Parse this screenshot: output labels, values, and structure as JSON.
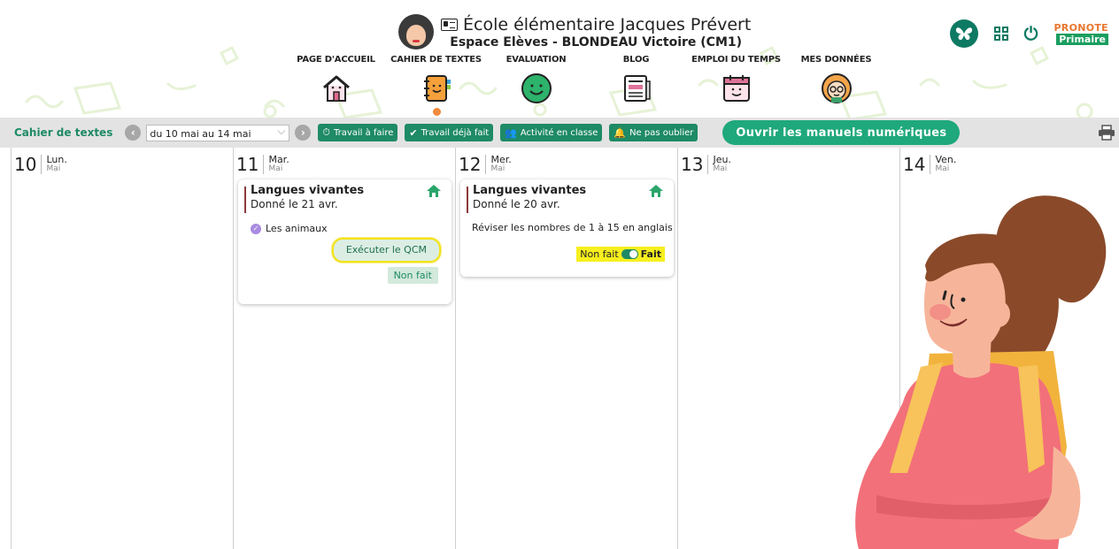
{
  "header": {
    "school_name": "École élémentaire Jacques Prévert",
    "student_line": "Espace Elèves - BLONDEAU Victoire (CM1)",
    "brand_top": "PRONOTE",
    "brand_bottom": "Primaire",
    "icons": [
      "butterfly-icon",
      "qr-code-icon",
      "power-icon"
    ]
  },
  "nav": [
    {
      "label": "PAGE D'ACCUEIL",
      "icon": "house-icon"
    },
    {
      "label": "CAHIER DE TEXTES",
      "icon": "notebook-icon",
      "active": true
    },
    {
      "label": "EVALUATION",
      "icon": "smiley-icon"
    },
    {
      "label": "BLOG",
      "icon": "newspaper-icon"
    },
    {
      "label": "EMPLOI DU TEMPS",
      "icon": "calendar-icon"
    },
    {
      "label": "MES DONNÉES",
      "icon": "student-icon"
    }
  ],
  "toolbar": {
    "title": "Cahier de textes",
    "prev": "‹",
    "next": "›",
    "date_range": "du 10 mai au 14 mai",
    "filters": [
      {
        "label": "Travail à faire",
        "icon": "clock-icon"
      },
      {
        "label": "Travail déjà fait",
        "icon": "check-icon"
      },
      {
        "label": "Activité en classe",
        "icon": "people-icon"
      },
      {
        "label": "Ne pas oublier",
        "icon": "bell-icon"
      }
    ],
    "open_manuals": "Ouvrir les manuels numériques",
    "print_icon": "printer-icon"
  },
  "days": [
    {
      "num": "10",
      "name": "Lun.",
      "month": "Mai"
    },
    {
      "num": "11",
      "name": "Mar.",
      "month": "Mai"
    },
    {
      "num": "12",
      "name": "Mer.",
      "month": "Mai"
    },
    {
      "num": "13",
      "name": "Jeu.",
      "month": "Mai"
    },
    {
      "num": "14",
      "name": "Ven.",
      "month": "Mai"
    }
  ],
  "cards": [
    {
      "subject": "Langues vivantes",
      "given": "Donné le 21 avr.",
      "topic": "Les animaux",
      "action": "Exécuter le QCM",
      "status": "Non fait"
    },
    {
      "subject": "Langues vivantes",
      "given": "Donné le 20 avr.",
      "text": "Réviser les nombres de 1 à 15 en anglais",
      "toggle_off": "Non fait",
      "toggle_on": "Fait"
    }
  ],
  "colors": {
    "accent_green": "#1e8a66",
    "button_green": "#1fa87b",
    "toolbar_bg": "#e3e3e3",
    "toggle_highlight": "#f7ef1e",
    "active_dot": "#f08a3c"
  }
}
